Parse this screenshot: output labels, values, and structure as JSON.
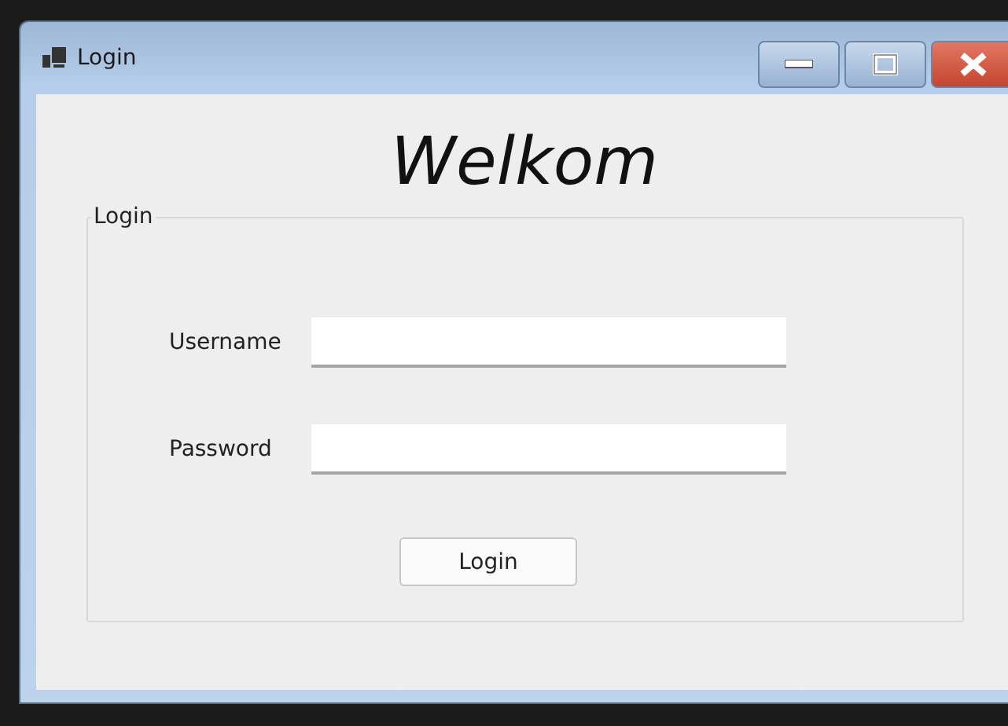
{
  "window": {
    "title": "Login"
  },
  "heading": "Welkom",
  "group": {
    "label": "Login"
  },
  "fields": [
    {
      "label": "Username"
    },
    {
      "label": "Password"
    }
  ],
  "button": "Login"
}
